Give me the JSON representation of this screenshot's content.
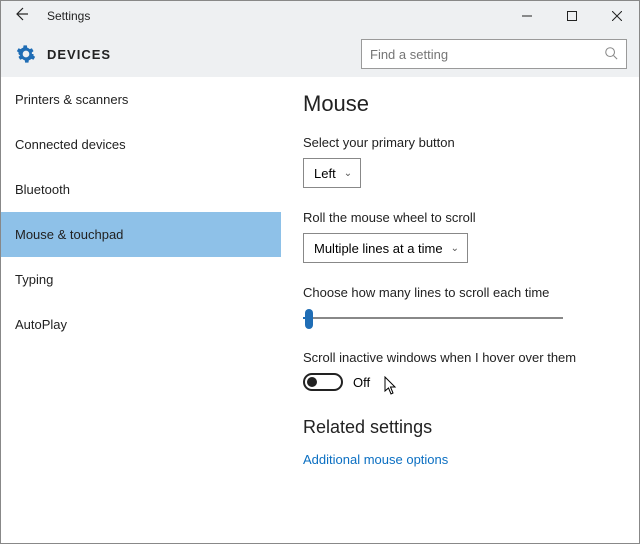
{
  "window": {
    "title": "Settings"
  },
  "header": {
    "section": "DEVICES",
    "search_placeholder": "Find a setting"
  },
  "sidebar": {
    "items": [
      {
        "label": "Printers & scanners"
      },
      {
        "label": "Connected devices"
      },
      {
        "label": "Bluetooth"
      },
      {
        "label": "Mouse & touchpad"
      },
      {
        "label": "Typing"
      },
      {
        "label": "AutoPlay"
      }
    ]
  },
  "main": {
    "heading": "Mouse",
    "primary_button": {
      "label": "Select your primary button",
      "value": "Left"
    },
    "wheel_scroll": {
      "label": "Roll the mouse wheel to scroll",
      "value": "Multiple lines at a time"
    },
    "lines_scroll": {
      "label": "Choose how many lines to scroll each time"
    },
    "hover_scroll": {
      "label": "Scroll inactive windows when I hover over them",
      "state_text": "Off"
    },
    "related_heading": "Related settings",
    "additional_link": "Additional mouse options"
  }
}
